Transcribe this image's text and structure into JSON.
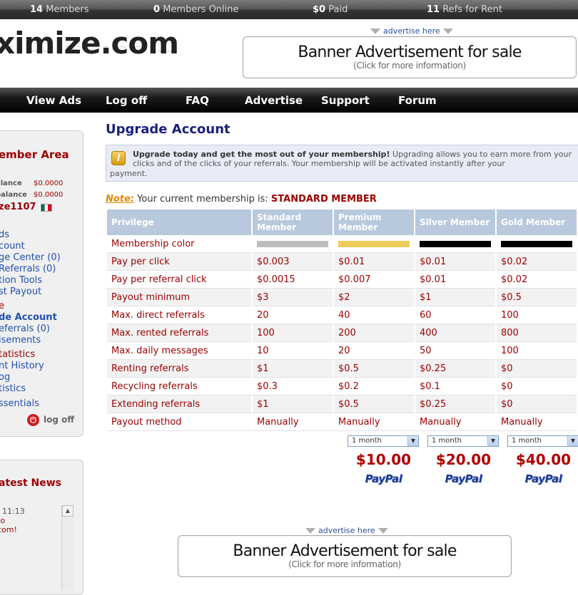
{
  "stats": [
    {
      "value": "14",
      "label": "Members"
    },
    {
      "value": "0",
      "label": "Members Online"
    },
    {
      "value": "$0",
      "label": "Paid"
    },
    {
      "value": "11",
      "label": "Refs for Rent"
    }
  ],
  "logo": "ximize.com",
  "advertise_link": "advertise here",
  "banner": {
    "title": "Banner Advertisement for sale",
    "subtitle": "(Click for more information)"
  },
  "nav": [
    "View Ads",
    "Log off",
    "FAQ",
    "Advertise",
    "Support",
    "Forum"
  ],
  "sidebar": {
    "title": "ember Area",
    "balances": [
      {
        "label": "alance",
        "value": "$0.0000"
      },
      {
        "label": "balance",
        "value": "$0.0000"
      }
    ],
    "username": "ze1107",
    "links": [
      "ds",
      "count",
      "ge Center (0)",
      "Referrals (0)",
      "tion Tools",
      "st Payout",
      "e",
      "de Account",
      "eferrals (0)",
      "isements",
      "tatistics",
      "nt History",
      "og",
      "tistics",
      "ssentials"
    ],
    "logoff": "log off",
    "news_title": "atest News",
    "news_lines": [
      ", 11:13",
      "to",
      "com!"
    ]
  },
  "main": {
    "title": "Upgrade Account",
    "info_bold": "Upgrade today and get the most out of your membership!",
    "info_rest": " Upgrading allows you to earn more from your clicks and of the clicks of your referrals. Your membership will be activated instantly after your",
    "info_line2": "payment.",
    "note_label": "Note:",
    "note_text": " Your current membership is: ",
    "note_membership": "STANDARD MEMBER"
  },
  "table": {
    "headers": [
      "Privilege",
      "Standard Member",
      "Premium Member",
      "Silver Member",
      "Gold Member"
    ],
    "colors": [
      "#bdbdbd",
      "#f0cd5a",
      "#000000",
      "#000000"
    ],
    "color_row_label": "Membership color",
    "rows": [
      [
        "Pay per click",
        "$0.003",
        "$0.01",
        "$0.01",
        "$0.02"
      ],
      [
        "Pay per referral click",
        "$0.0015",
        "$0.007",
        "$0.01",
        "$0.02"
      ],
      [
        "Payout minimum",
        "$3",
        "$2",
        "$1",
        "$0.5"
      ],
      [
        "Max. direct referrals",
        "20",
        "40",
        "60",
        "100"
      ],
      [
        "Max. rented referrals",
        "100",
        "200",
        "400",
        "800"
      ],
      [
        "Max. daily messages",
        "10",
        "20",
        "50",
        "100"
      ],
      [
        "Renting referrals",
        "$1",
        "$0.5",
        "$0.25",
        "$0"
      ],
      [
        "Recycling referrals",
        "$0.3",
        "$0.2",
        "$0.1",
        "$0"
      ],
      [
        "Extending referrals",
        "$1",
        "$0.5",
        "$0.25",
        "$0"
      ],
      [
        "Payout method",
        "Manually",
        "Manually",
        "Manually",
        "Manually"
      ]
    ]
  },
  "purchase": [
    {
      "duration": "1 month",
      "price": "$10.00",
      "button": "PayPal"
    },
    {
      "duration": "1 month",
      "price": "$20.00",
      "button": "PayPal"
    },
    {
      "duration": "1 month",
      "price": "$40.00",
      "button": "PayPal"
    }
  ]
}
